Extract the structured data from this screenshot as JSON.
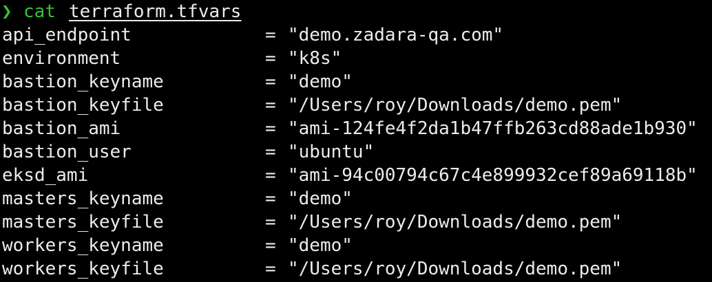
{
  "terminal": {
    "prompt_symbol": "❯",
    "command": "cat",
    "argument": "terraform.tfvars",
    "equals": "=",
    "rows": [
      {
        "key": "api_endpoint",
        "value": "\"demo.zadara-qa.com\""
      },
      {
        "key": "environment",
        "value": "\"k8s\""
      },
      {
        "key": "bastion_keyname",
        "value": "\"demo\""
      },
      {
        "key": "bastion_keyfile",
        "value": "\"/Users/roy/Downloads/demo.pem\""
      },
      {
        "key": "bastion_ami",
        "value": "\"ami-124fe4f2da1b47ffb263cd88ade1b930\""
      },
      {
        "key": "bastion_user",
        "value": "\"ubuntu\""
      },
      {
        "key": "eksd_ami",
        "value": "\"ami-94c00794c67c4e899932cef89a69118b\""
      },
      {
        "key": "masters_keyname",
        "value": "\"demo\""
      },
      {
        "key": "masters_keyfile",
        "value": "\"/Users/roy/Downloads/demo.pem\""
      },
      {
        "key": "workers_keyname",
        "value": "\"demo\""
      },
      {
        "key": "workers_keyfile",
        "value": "\"/Users/roy/Downloads/demo.pem\""
      }
    ]
  },
  "colors": {
    "background": "#000000",
    "foreground": "#ececec",
    "prompt_green": "#35c23a"
  }
}
